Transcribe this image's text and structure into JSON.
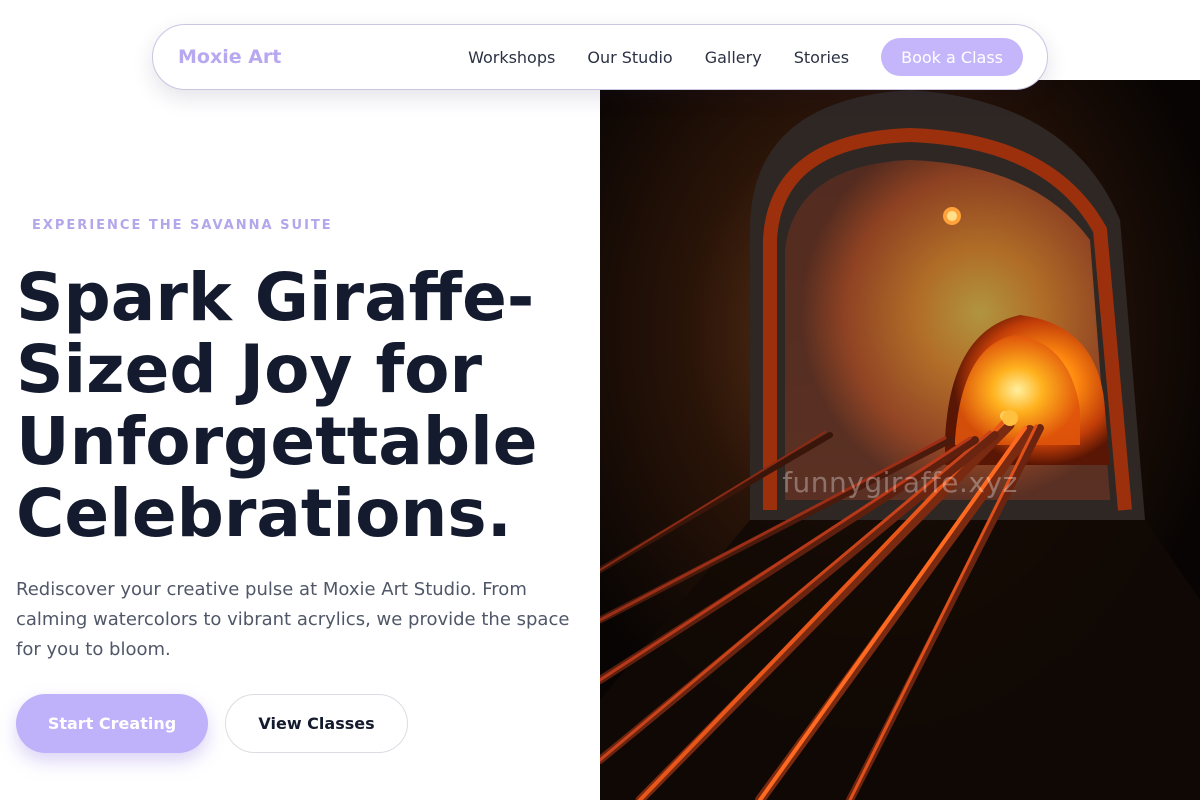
{
  "nav": {
    "brand": "Moxie Art",
    "links": [
      "Workshops",
      "Our Studio",
      "Gallery",
      "Stories"
    ],
    "cta_label": "Book a Class"
  },
  "hero": {
    "eyebrow": "EXPERIENCE THE SAVANNA SUITE",
    "headline_lines": [
      "Spark Giraffe-",
      "Sized Joy for",
      "Unforgettable",
      "Celebrations."
    ],
    "subtext": "Rediscover your creative pulse at Moxie Art Studio. From calming watercolors to vibrant acrylics, we provide the space for you to bloom.",
    "primary_cta": "Start Creating",
    "secondary_cta": "View Classes",
    "image_watermark": "funnygiraffe.xyz"
  },
  "colors": {
    "brand": "#b8a8ef",
    "cta": "#c5b6fb",
    "heading": "#141b2e",
    "body_text": "#4f5768"
  },
  "icons": {
    "hero_image": "glass-kiln-photo"
  }
}
